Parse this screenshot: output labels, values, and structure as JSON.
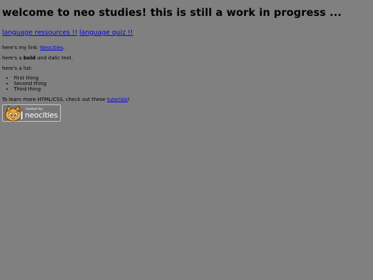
{
  "page": {
    "heading": "welcome to neo studies! this is still a work in progress ...",
    "nav_links": [
      {
        "label": "language ressources !!"
      },
      {
        "label": "language quiz !!"
      }
    ],
    "link_para": {
      "prefix": "here's my link: ",
      "link_text": "Neocities",
      "suffix": "."
    },
    "bold_para": {
      "prefix": "here's a ",
      "bold_text": "bold",
      "middle": " and ",
      "italic_text": "italic",
      "suffix": " text."
    },
    "list_intro": "here's a list:",
    "list_items": [
      "First thing",
      "Second thing",
      "Third thing"
    ],
    "learn_para": {
      "prefix": "To learn more HTML/CSS, check out these ",
      "link_text": "tutorials",
      "suffix": "!"
    },
    "badge": {
      "hosted_text": "hosted by",
      "brand_text": "neocities",
      "icon": "neocities-cat-icon"
    }
  },
  "colors": {
    "background": "#808080",
    "link": "#0000ee",
    "text": "#000000"
  }
}
